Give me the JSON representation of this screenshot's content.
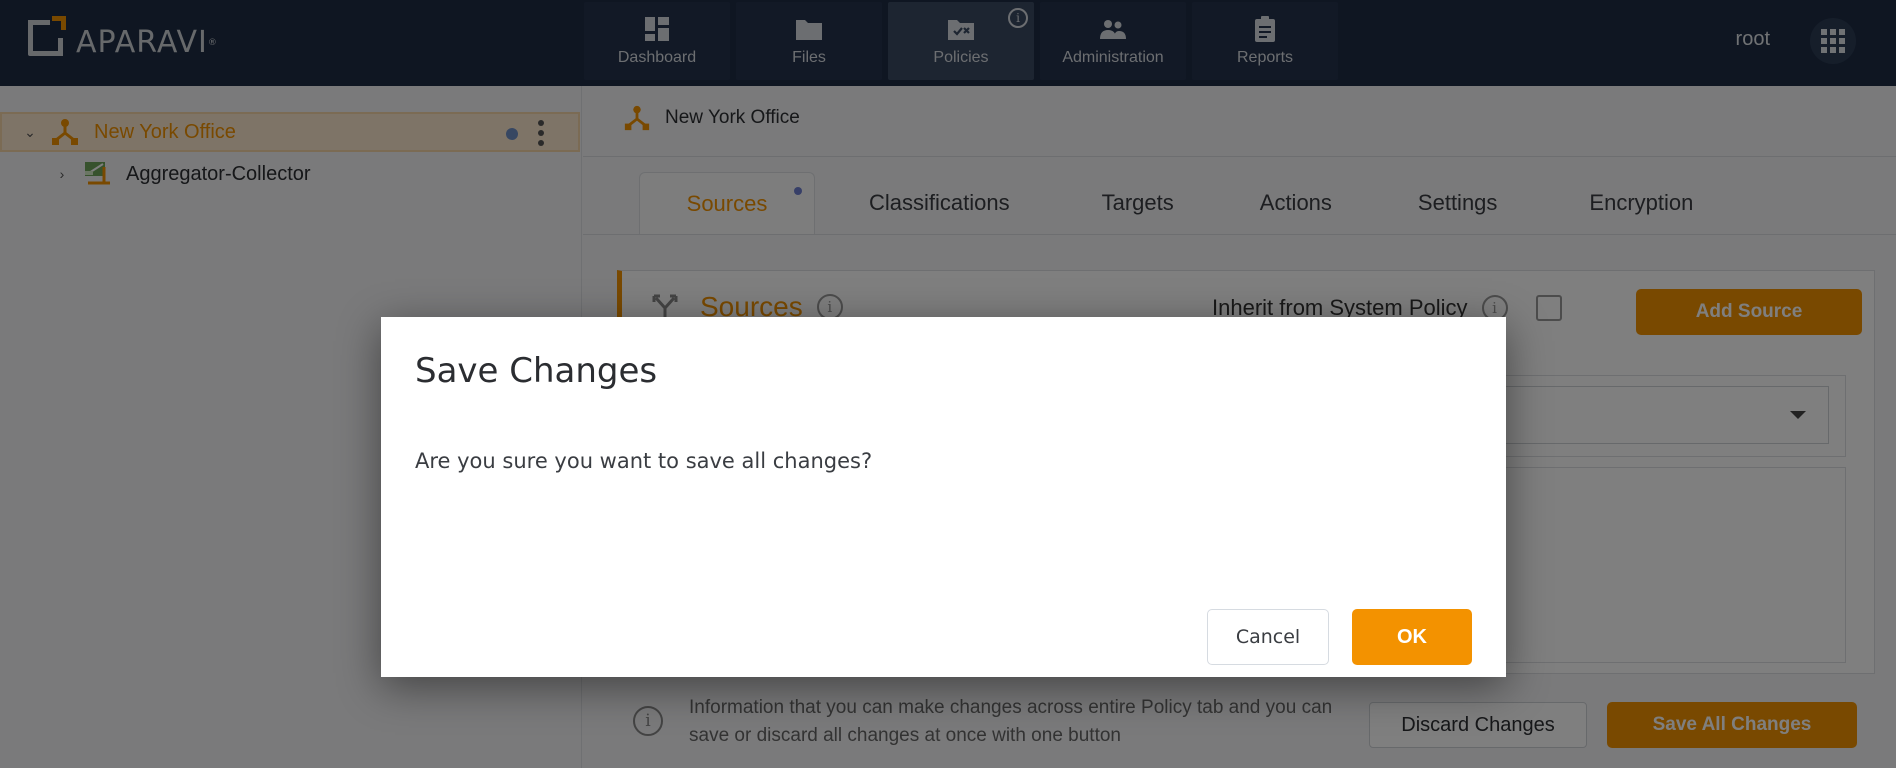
{
  "app": {
    "logo_text": "APARAVI",
    "logo_mark": "®"
  },
  "nav": {
    "items": [
      {
        "label": "Dashboard",
        "icon": "dashboard-icon"
      },
      {
        "label": "Files",
        "icon": "folder-icon"
      },
      {
        "label": "Policies",
        "icon": "policy-folder-icon",
        "active": true,
        "info": "i"
      },
      {
        "label": "Administration",
        "icon": "users-icon"
      },
      {
        "label": "Reports",
        "icon": "clipboard-icon"
      }
    ],
    "user": "root",
    "apps_icon": "grid-apps-icon"
  },
  "sidebar": {
    "tree": [
      {
        "label": "New York Office",
        "icon": "network-node-icon",
        "expanded": true,
        "selected": true,
        "chevron": "⌄"
      },
      {
        "label": "Aggregator-Collector",
        "icon": "aggregator-collector-icon",
        "expanded": false,
        "chevron": "›"
      }
    ]
  },
  "main": {
    "breadcrumb": "New York Office",
    "tabs": [
      {
        "label": "Sources",
        "active": true,
        "modified": true
      },
      {
        "label": "Classifications"
      },
      {
        "label": "Targets"
      },
      {
        "label": "Actions"
      },
      {
        "label": "Settings"
      },
      {
        "label": "Encryption"
      }
    ],
    "sources_panel": {
      "title": "Sources",
      "info": "i",
      "inherit_label": "Inherit from System Policy",
      "inherit_checked": false,
      "add_source_label": "Add Source"
    },
    "footer": {
      "info": "i",
      "text": "Information that you can make changes across entire Policy tab and you can save or discard all changes at once with one button",
      "discard_label": "Discard Changes",
      "save_all_label": "Save All Changes"
    }
  },
  "modal": {
    "title": "Save Changes",
    "message": "Are you sure you want to save all changes?",
    "cancel_label": "Cancel",
    "ok_label": "OK"
  },
  "colors": {
    "accent": "#f39200",
    "topbar": "#1e2d45",
    "modified_dot": "#6f7fd0"
  }
}
